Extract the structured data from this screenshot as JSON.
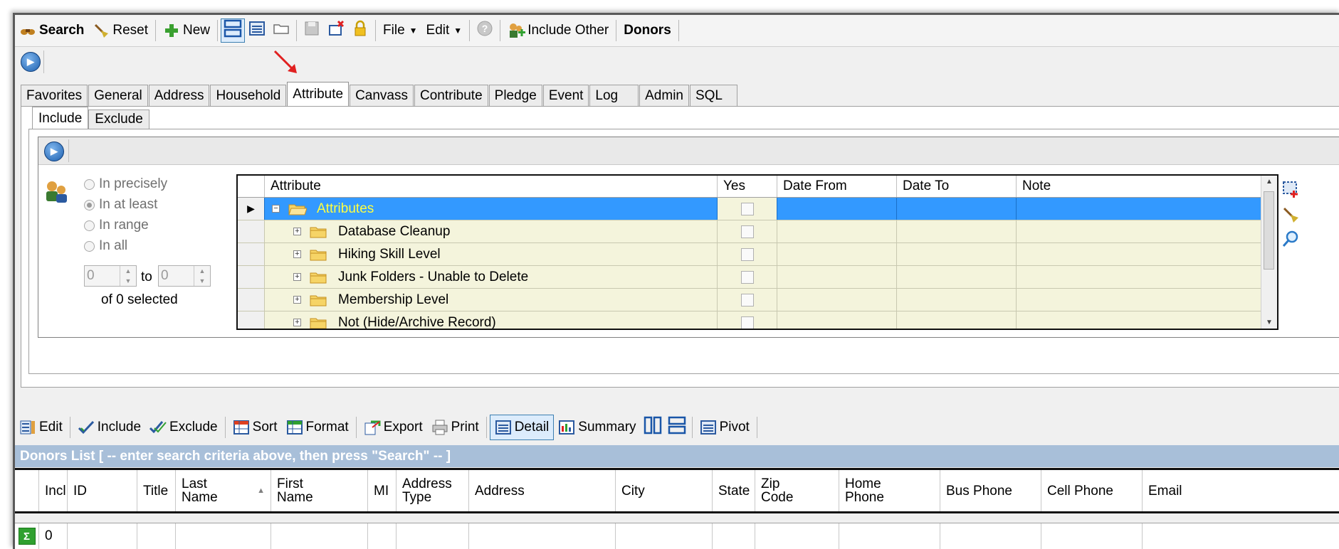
{
  "toolbar": {
    "search_label": "Search",
    "reset_label": "Reset",
    "new_label": "New",
    "file_label": "File",
    "edit_label": "Edit",
    "include_other_label": "Include Other",
    "donors_label": "Donors"
  },
  "tabs": [
    "Favorites",
    "General",
    "Address",
    "Household",
    "Attribute",
    "Canvass",
    "Contribute",
    "Pledge",
    "Event",
    "Log",
    "Admin",
    "SQL"
  ],
  "active_tab": "Attribute",
  "subtabs": [
    "Include",
    "Exclude"
  ],
  "criteria": {
    "options": [
      "In precisely",
      "In at least",
      "In range",
      "In all"
    ],
    "selected": "In at least",
    "range_from": "0",
    "range_to_label": "to",
    "range_to": "0",
    "summary": "of 0 selected"
  },
  "grid": {
    "columns": [
      "Attribute",
      "Yes",
      "Date From",
      "Date To",
      "Note"
    ],
    "rows": [
      {
        "label": "Attributes",
        "expander": "−"
      },
      {
        "label": "Database Cleanup",
        "expander": "+"
      },
      {
        "label": "Hiking Skill Level",
        "expander": "+"
      },
      {
        "label": "Junk Folders - Unable to Delete",
        "expander": "+"
      },
      {
        "label": "Membership Level",
        "expander": "+"
      },
      {
        "label": "Not (Hide/Archive Record)",
        "expander": "+"
      }
    ]
  },
  "bottom_toolbar": {
    "edit_label": "Edit",
    "include_label": "Include",
    "exclude_label": "Exclude",
    "sort_label": "Sort",
    "format_label": "Format",
    "export_label": "Export",
    "print_label": "Print",
    "detail_label": "Detail",
    "summary_label": "Summary",
    "pivot_label": "Pivot"
  },
  "list": {
    "title": "Donors List [ -- enter search criteria above, then press \"Search\" -- ]",
    "columns": [
      "Incl",
      "ID",
      "Title",
      "Last\nName",
      "First\nName",
      "MI",
      "Address\nType",
      "Address",
      "City",
      "State",
      "Zip\nCode",
      "Home\nPhone",
      "Bus Phone",
      "Cell Phone",
      "Email"
    ],
    "footer_count": "0"
  },
  "colors": {
    "selection": "#3399ff",
    "row_bg": "#f4f4dc",
    "list_title_bg": "#a8bfd9",
    "arrow": "#e02020"
  }
}
